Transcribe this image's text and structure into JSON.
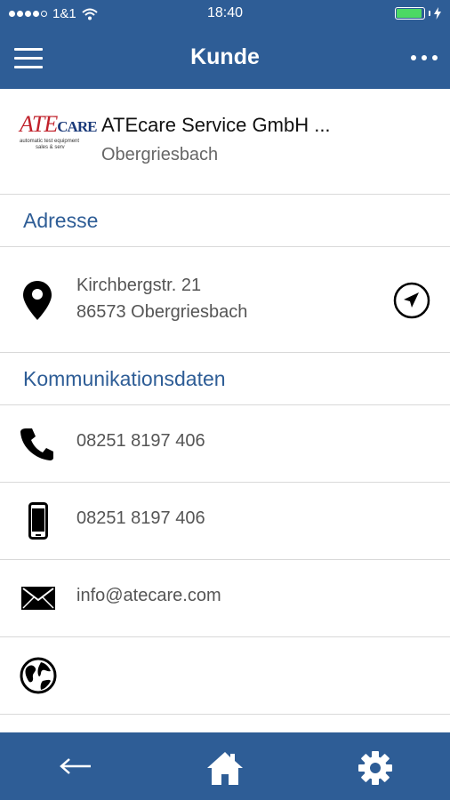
{
  "status": {
    "carrier": "1&1",
    "time": "18:40"
  },
  "header": {
    "title": "Kunde"
  },
  "customer": {
    "logo_text": "ATEcare",
    "logo_subtext": "automatic test equipment sales & service",
    "name": "ATEcare Service GmbH ...",
    "city": "Obergriesbach"
  },
  "sections": {
    "address_title": "Adresse",
    "communication_title": "Kommunikationsdaten"
  },
  "address": {
    "street": "Kirchbergstr. 21",
    "city_line": "86573 Obergriesbach"
  },
  "communication": {
    "phone": "08251 8197 406",
    "mobile": "08251 8197 406",
    "email": "info@atecare.com",
    "website": ""
  },
  "colors": {
    "accent": "#2e5d96",
    "battery": "#4cd964",
    "logo_red": "#c0202a"
  },
  "icons": {
    "menu": "hamburger-icon",
    "more": "more-icon",
    "location": "map-pin-icon",
    "navigate": "navigate-icon",
    "phone": "phone-icon",
    "mobile": "mobile-icon",
    "email": "mail-icon",
    "web": "globe-icon",
    "back": "back-arrow-icon",
    "home": "home-icon",
    "settings": "gear-icon"
  }
}
